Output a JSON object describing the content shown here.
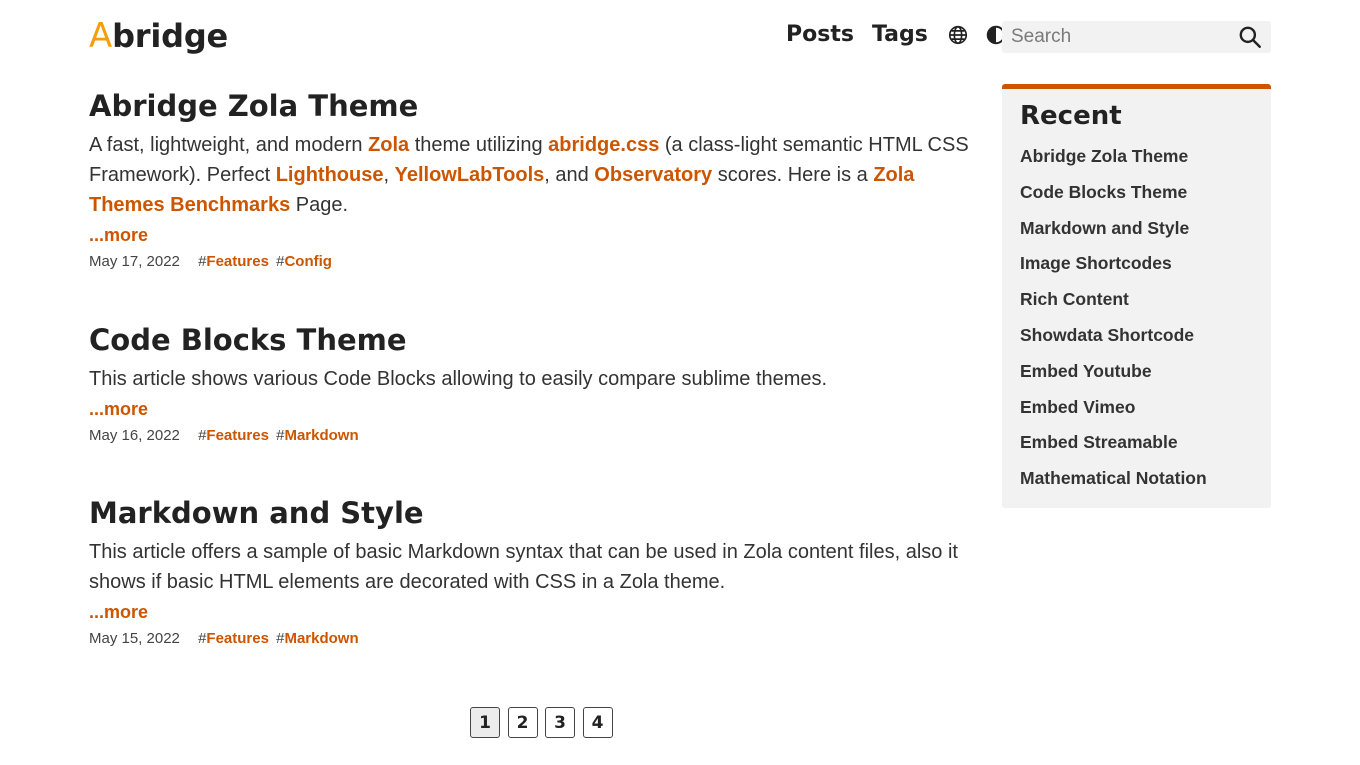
{
  "header": {
    "logo_accent": "A",
    "logo_rest": "bridge",
    "nav": [
      {
        "label": "Posts"
      },
      {
        "label": "Tags"
      }
    ],
    "icons": [
      "globe-icon",
      "contrast-icon",
      "search-icon"
    ],
    "search": {
      "placeholder": "Search",
      "value": ""
    }
  },
  "colors": {
    "accent": "#cc5500",
    "logo_accent": "#f59e0b",
    "panel": "#f2f2f2"
  },
  "posts": [
    {
      "title": "Abridge Zola Theme",
      "summary": {
        "t1": "A fast, lightweight, and modern ",
        "l1": "Zola",
        "t2": " theme utilizing ",
        "l2": "abridge.css",
        "t3": " (a class-light semantic HTML CSS Framework). Perfect ",
        "l3": "Lighthouse",
        "t4": ", ",
        "l4": "YellowLabTools",
        "t5": ", and ",
        "l5": "Observatory",
        "t6": " scores. Here is a ",
        "l6": "Zola Themes Benchmarks",
        "t7": " Page."
      },
      "more": "...more",
      "date": "May 17, 2022",
      "tags": [
        "Features",
        "Config"
      ]
    },
    {
      "title": "Code Blocks Theme",
      "summary": {
        "t1": "This article shows various Code Blocks allowing to easily compare sublime themes."
      },
      "more": "...more",
      "date": "May 16, 2022",
      "tags": [
        "Features",
        "Markdown"
      ]
    },
    {
      "title": "Markdown and Style",
      "summary": {
        "t1": "This article offers a sample of basic Markdown syntax that can be used in Zola content files, also it shows if basic HTML elements are decorated with CSS in a Zola theme."
      },
      "more": "...more",
      "date": "May 15, 2022",
      "tags": [
        "Features",
        "Markdown"
      ]
    }
  ],
  "tag_prefix": "#",
  "pagination": {
    "pages": [
      "1",
      "2",
      "3",
      "4"
    ],
    "current": "1"
  },
  "sidebar": {
    "title": "Recent",
    "items": [
      "Abridge Zola Theme",
      "Code Blocks Theme",
      "Markdown and Style",
      "Image Shortcodes",
      "Rich Content",
      "Showdata Shortcode",
      "Embed Youtube",
      "Embed Vimeo",
      "Embed Streamable",
      "Mathematical Notation"
    ]
  }
}
